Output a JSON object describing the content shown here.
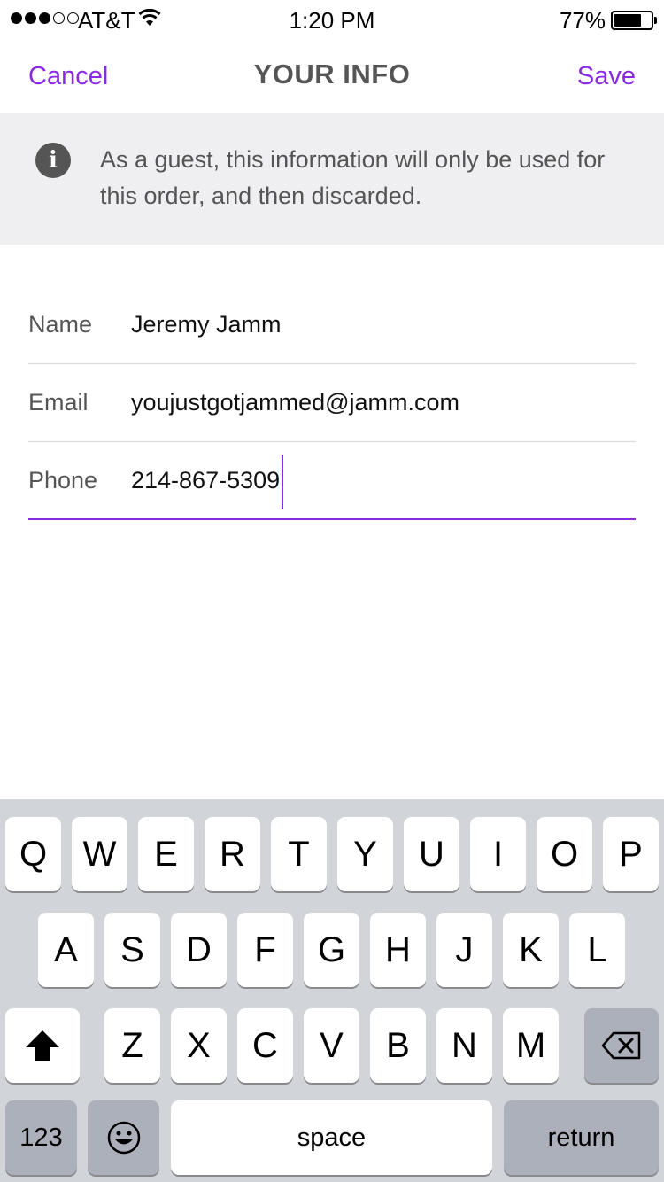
{
  "status_bar": {
    "carrier": "AT&T",
    "time": "1:20 PM",
    "battery": "77%",
    "battery_level": 0.77
  },
  "nav": {
    "cancel_label": "Cancel",
    "title": "YOUR INFO",
    "save_label": "Save"
  },
  "banner": {
    "icon": "info-icon",
    "text": "As a guest, this information will only be used for this order, and then discarded."
  },
  "form": {
    "fields": [
      {
        "label": "Name",
        "value": "Jeremy Jamm"
      },
      {
        "label": "Email",
        "value": "youjustgotjammed@jamm.com"
      },
      {
        "label": "Phone",
        "value": "214-867-5309"
      }
    ]
  },
  "keyboard": {
    "row1": [
      "Q",
      "W",
      "E",
      "R",
      "T",
      "Y",
      "U",
      "I",
      "O",
      "P"
    ],
    "row2": [
      "A",
      "S",
      "D",
      "F",
      "G",
      "H",
      "J",
      "K",
      "L"
    ],
    "row3": [
      "Z",
      "X",
      "C",
      "V",
      "B",
      "N",
      "M"
    ],
    "numbers_label": "123",
    "space_label": "space",
    "return_label": "return"
  },
  "colors": {
    "accent": "#8a2be2",
    "banner_bg": "#efeff1",
    "keyboard_bg": "#d1d4d9"
  }
}
